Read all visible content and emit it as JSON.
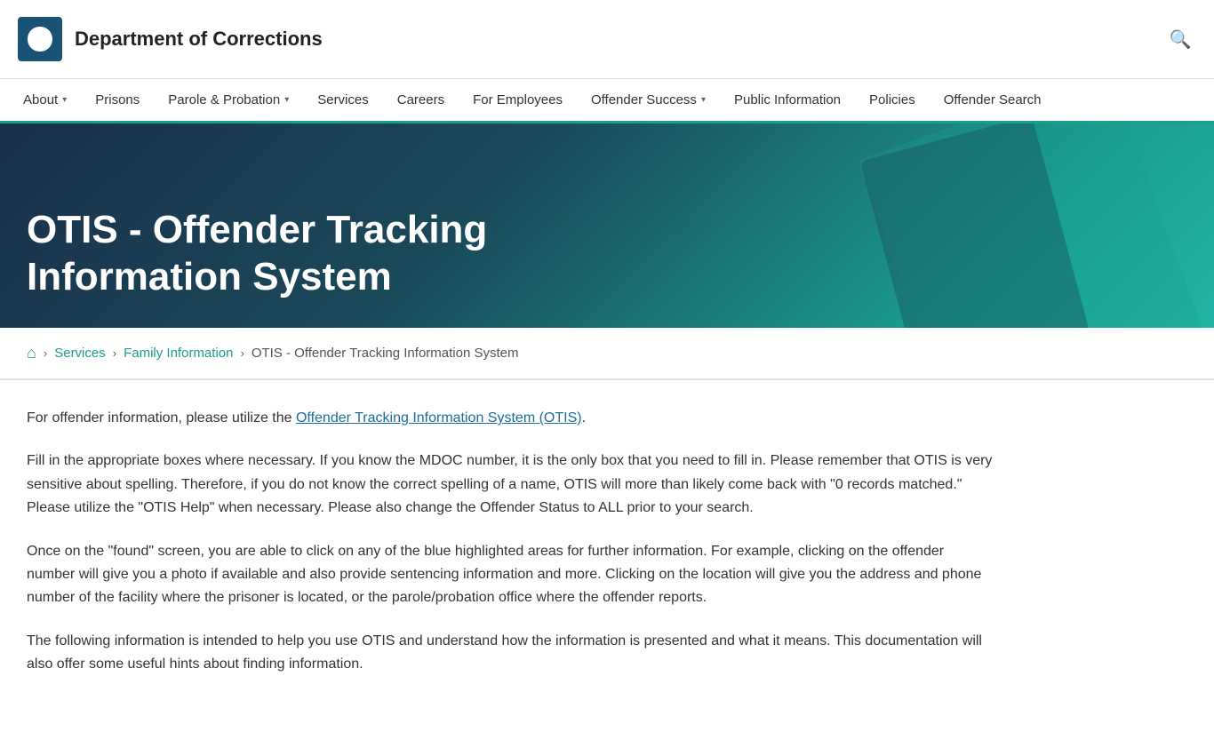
{
  "header": {
    "title": "Department of Corrections",
    "logo_alt": "Michigan DOC logo"
  },
  "nav": {
    "items": [
      {
        "label": "About",
        "has_dropdown": true
      },
      {
        "label": "Prisons",
        "has_dropdown": false
      },
      {
        "label": "Parole & Probation",
        "has_dropdown": true
      },
      {
        "label": "Services",
        "has_dropdown": false
      },
      {
        "label": "Careers",
        "has_dropdown": false
      },
      {
        "label": "For Employees",
        "has_dropdown": false
      },
      {
        "label": "Offender Success",
        "has_dropdown": true
      },
      {
        "label": "Public Information",
        "has_dropdown": false
      },
      {
        "label": "Policies",
        "has_dropdown": false
      },
      {
        "label": "Offender Search",
        "has_dropdown": false
      }
    ]
  },
  "hero": {
    "title": "OTIS - Offender Tracking Information System"
  },
  "breadcrumb": {
    "home_label": "🏠",
    "items": [
      {
        "label": "Services",
        "link": true
      },
      {
        "label": "Family Information",
        "link": true
      },
      {
        "label": "OTIS - Offender Tracking Information System",
        "link": false
      }
    ]
  },
  "content": {
    "para1_prefix": "For offender information, please utilize the ",
    "para1_link": "Offender Tracking Information System (OTIS)",
    "para1_suffix": ".",
    "para2": "Fill in the appropriate boxes where necessary.  If you know the MDOC number, it is the only box that you need to fill in.  Please remember that OTIS is very sensitive about spelling.  Therefore, if you do not know the correct spelling of a name, OTIS will more than likely come back with \"0 records matched.\" Please utilize the \"OTIS Help\" when necessary.  Please also change the Offender Status to ALL prior to your search.",
    "para3": "Once on the \"found\" screen, you are able to click on any of the blue highlighted areas for further information.  For example, clicking on the offender number will give you a photo if available and also provide sentencing information and more.  Clicking on the location will give you the address and phone number of the facility where the prisoner is located, or the parole/probation office where the offender reports.",
    "para4": "The following information is intended to help you use OTIS and understand how the information is presented and what it means. This documentation will also offer some useful hints about finding information."
  },
  "colors": {
    "teal": "#1a9e8f",
    "navy": "#1a2f4a",
    "link_blue": "#1a6e9e"
  }
}
